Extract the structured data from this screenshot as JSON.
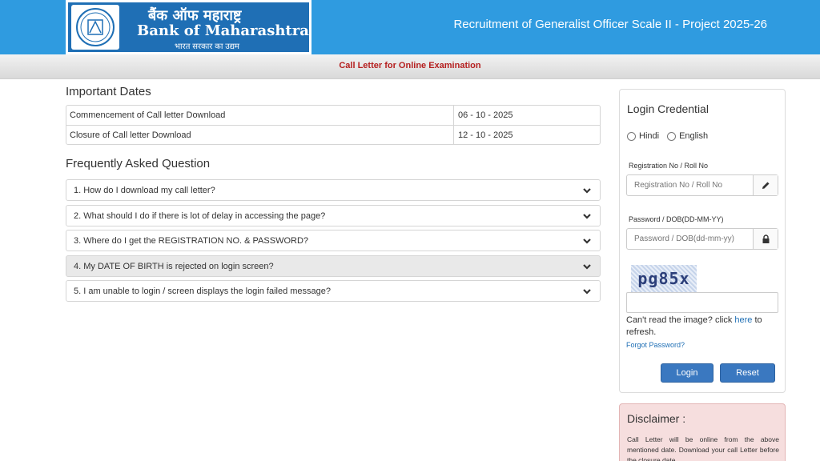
{
  "header": {
    "logo_hindi": "बैंक ऑफ महाराष्ट्र",
    "logo_english": "Bank of Maharashtra",
    "logo_tagline": "भारत सरकार का उद्यम",
    "title": "Recruitment of Generalist Officer Scale II - Project 2025-26"
  },
  "subbar": {
    "label": "Call Letter for Online Examination"
  },
  "important_dates": {
    "title": "Important Dates",
    "rows": [
      {
        "label": "Commencement of Call letter Download",
        "value": "06 - 10 - 2025"
      },
      {
        "label": "Closure of Call letter Download",
        "value": "12 - 10 - 2025"
      }
    ]
  },
  "faq": {
    "title": "Frequently Asked Question",
    "items": [
      "1. How do I download my call letter?",
      "2. What should I do if there is lot of delay in accessing the page?",
      "3. Where do I get the REGISTRATION NO. & PASSWORD?",
      "4. My DATE OF BIRTH is rejected on login screen?",
      "5. I am unable to login / screen displays the login failed message?"
    ]
  },
  "login": {
    "title": "Login Credential",
    "lang_hindi": "Hindi",
    "lang_english": "English",
    "reg_label": "Registration No / Roll No",
    "reg_placeholder": "Registration No / Roll No",
    "pwd_label": "Password / DOB(DD-MM-YY)",
    "pwd_placeholder": "Password / DOB(dd-mm-yy)",
    "captcha_text": "pg85x",
    "cant_read_prefix": "Can't read the image? click ",
    "cant_read_link": "here",
    "cant_read_suffix": " to refresh.",
    "forgot": "Forgot Password?",
    "login_button": "Login",
    "reset_button": "Reset"
  },
  "disclaimer": {
    "title": "Disclaimer :",
    "text": "Call Letter will be online from the above mentioned date. Download your call Letter before the closure date."
  },
  "colors": {
    "header_bg": "#2f9be0",
    "logo_bg": "#1f6fb5",
    "button": "#3a78c0",
    "subbar_text": "#b51f1f",
    "disclaimer_bg": "#f6dede"
  },
  "icons": {
    "edit": "pencil-icon",
    "lock": "lock-icon",
    "chevron": "chevron-down-icon"
  }
}
